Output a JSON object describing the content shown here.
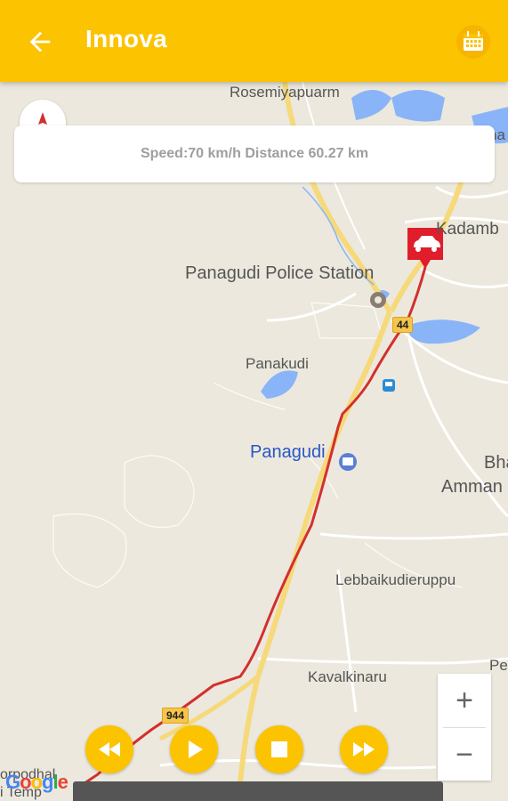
{
  "appbar": {
    "title": "Innova"
  },
  "info": {
    "text": "Speed:70 km/h Distance 60.27 km"
  },
  "map": {
    "labels": {
      "rosemiyapuarm": "Rosemiyapuarm",
      "kadamb": "Kadamb",
      "police": "Panagudi Police Station",
      "panakudi": "Panakudi",
      "panagudi": "Panagudi",
      "bha": "Bha",
      "amman": "Amman",
      "lebbai": "Lebbaikudieruppu",
      "kavalkinaru": "Kavalkinaru",
      "pe": "Pe",
      "corner_bottom1": "orpodhal",
      "corner_bottom2": "i Temp",
      "na": "na"
    },
    "highways": {
      "nh44": "44",
      "r944": "944"
    }
  },
  "zoom": {
    "in": "+",
    "out": "−"
  },
  "google": {
    "letters": [
      "G",
      "o",
      "o",
      "g",
      "l",
      "e"
    ]
  }
}
